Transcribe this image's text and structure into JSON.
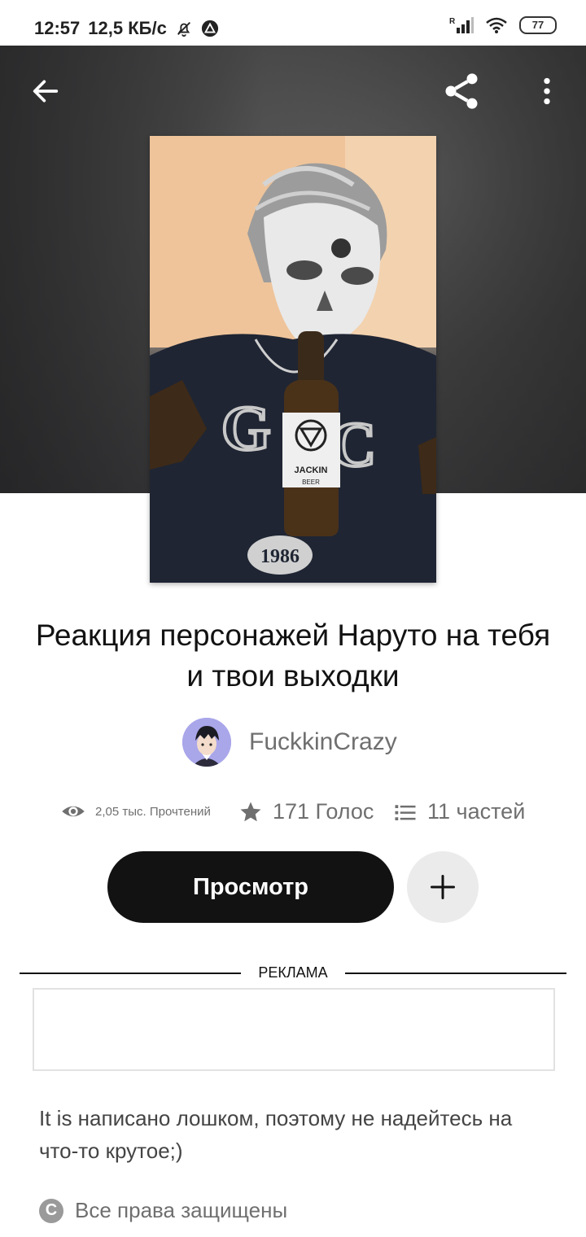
{
  "status_bar": {
    "time": "12:57",
    "speed": "12,5 КБ/с",
    "battery": "77",
    "icons": [
      "bell-off-icon",
      "warning-triangle-icon",
      "signal-icon",
      "wifi-icon",
      "battery-icon"
    ]
  },
  "toolbar": {
    "back_icon": "arrow-left-icon",
    "share_icon": "share-icon",
    "menu_icon": "more-vertical-icon"
  },
  "story": {
    "title": "Реакция персонажей Наруто на тебя и твои выходки",
    "author": "FuckkinCrazy",
    "cover_text": {
      "shirt_left": "G",
      "shirt_right": "C",
      "bottle_label": "JACKIN",
      "bottle_sub": "BEER",
      "year": "1986"
    },
    "stats": {
      "reads": "2,05 тыс. Прочтений",
      "votes": "171 Голос",
      "parts": "11 частей"
    },
    "read_button": "Просмотр",
    "add_button_icon": "plus-icon",
    "ad_label": "РЕКЛАМА",
    "description": "It is написано лошком, поэтому не надейтесь на что-то крутое;)",
    "copyright": "Все права защищены"
  },
  "colors": {
    "primary_button": "#121212",
    "secondary_button": "#ebebec",
    "muted_text": "#6f6f6f",
    "avatar_bg": "#a9a6ea"
  }
}
